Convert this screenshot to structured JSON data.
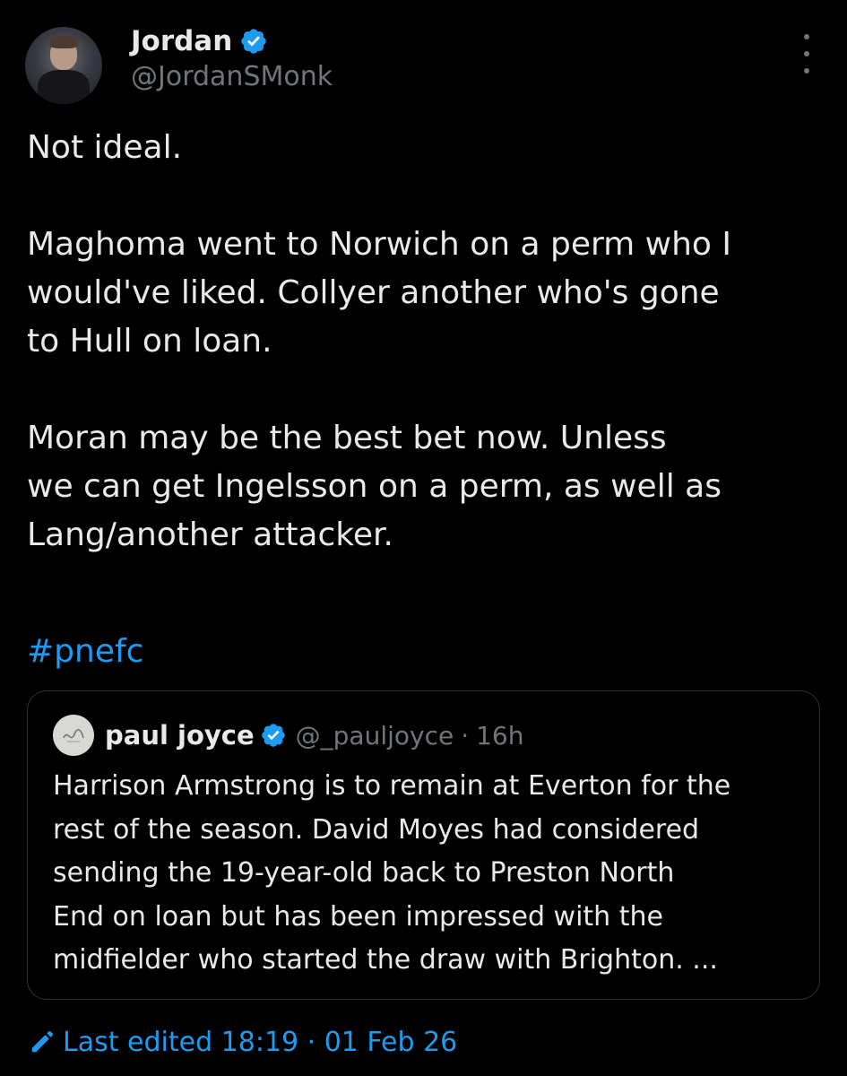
{
  "author": {
    "display_name": "Jordan",
    "handle": "@JordanSMonk",
    "verified_icon": "verified-badge-icon"
  },
  "menu": {
    "icon": "more-options-icon"
  },
  "tweet": {
    "paragraphs": [
      "Not ideal.",
      "Maghoma went to Norwich on a perm who I\nwould've liked. Collyer another who's gone\nto Hull on loan.",
      "Moran may be the best bet now. Unless\nwe can get Ingelsson on a perm, as well as\nLang/another attacker."
    ],
    "hashtag": "#pnefc"
  },
  "quote": {
    "display_name": "paul joyce",
    "handle": "@_pauljoyce",
    "separator": "·",
    "time": "16h",
    "lines": [
      "Harrison Armstrong is to remain at Everton for the",
      "rest of the season. David Moyes had considered",
      "sending the 19-year-old back to Preston North",
      "End on loan but has been impressed with the",
      "midfielder who started the draw with Brighton. ..."
    ]
  },
  "footer": {
    "edited_label": "Last edited 18:19 · 01 Feb 26",
    "icon": "edit-pencil-icon"
  },
  "colors": {
    "background": "#000000",
    "text": "#e7e9ea",
    "muted": "#71767b",
    "accent": "#1d9bf0",
    "border": "#2f3336"
  }
}
